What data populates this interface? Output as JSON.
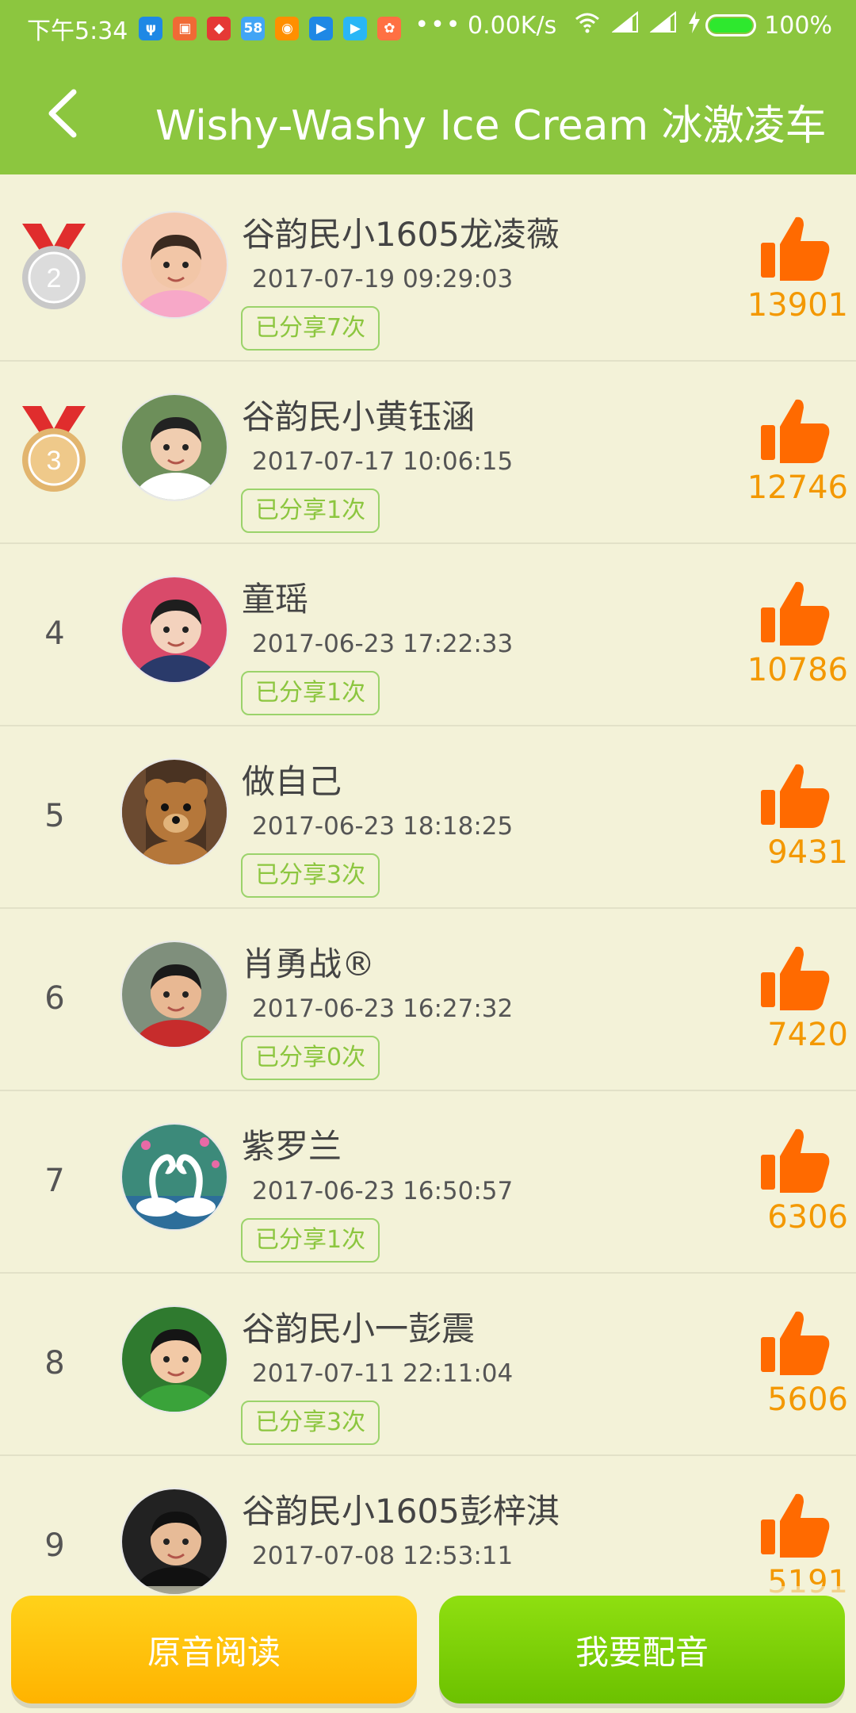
{
  "status_bar": {
    "time": "下午5:34",
    "net_speed": "0.00K/s",
    "battery": "100%",
    "more": "•••",
    "notifications": [
      {
        "icon": "alipay-icon",
        "color": "#1e88e5",
        "glyph": "ψ"
      },
      {
        "icon": "app-icon",
        "color": "#f06a35",
        "glyph": "▣"
      },
      {
        "icon": "news-icon",
        "color": "#e53935",
        "glyph": "◆"
      },
      {
        "icon": "58-icon",
        "color": "#42a5f5",
        "glyph": "58"
      },
      {
        "icon": "weibo-icon",
        "color": "#ff8f00",
        "glyph": "◉"
      },
      {
        "icon": "video-icon",
        "color": "#1e88e5",
        "glyph": "▶"
      },
      {
        "icon": "play-icon",
        "color": "#29b6f6",
        "glyph": "▶"
      },
      {
        "icon": "uc-icon",
        "color": "#ff7043",
        "glyph": "✿"
      }
    ]
  },
  "header": {
    "title": "Wishy-Washy Ice Cream  冰激凌车"
  },
  "colors": {
    "green": "#8cc63f",
    "orange": "#f39800",
    "like": "#ff6a00"
  },
  "rows": [
    {
      "rank": "2",
      "medal": "silver",
      "name": "谷韵民小1605龙凌薇",
      "time": "2017-07-19 09:29:03",
      "shares": "已分享7次",
      "likes": "13901"
    },
    {
      "rank": "3",
      "medal": "bronze",
      "name": "谷韵民小黄钰涵",
      "time": "2017-07-17 10:06:15",
      "shares": "已分享1次",
      "likes": "12746"
    },
    {
      "rank": "4",
      "medal": "",
      "name": "童瑶",
      "time": "2017-06-23 17:22:33",
      "shares": "已分享1次",
      "likes": "10786"
    },
    {
      "rank": "5",
      "medal": "",
      "name": "做自己",
      "time": "2017-06-23 18:18:25",
      "shares": "已分享3次",
      "likes": "9431"
    },
    {
      "rank": "6",
      "medal": "",
      "name": "肖勇战®",
      "time": "2017-06-23 16:27:32",
      "shares": "已分享0次",
      "likes": "7420"
    },
    {
      "rank": "7",
      "medal": "",
      "name": "紫罗兰",
      "time": "2017-06-23 16:50:57",
      "shares": "已分享1次",
      "likes": "6306"
    },
    {
      "rank": "8",
      "medal": "",
      "name": "谷韵民小一彭震",
      "time": "2017-07-11 22:11:04",
      "shares": "已分享3次",
      "likes": "5606"
    },
    {
      "rank": "9",
      "medal": "",
      "name": "谷韵民小1605彭梓淇",
      "time": "2017-07-08 12:53:11",
      "shares": "",
      "likes": "5191"
    }
  ],
  "bottom": {
    "original_label": "原音阅读",
    "dub_label": "我要配音"
  }
}
